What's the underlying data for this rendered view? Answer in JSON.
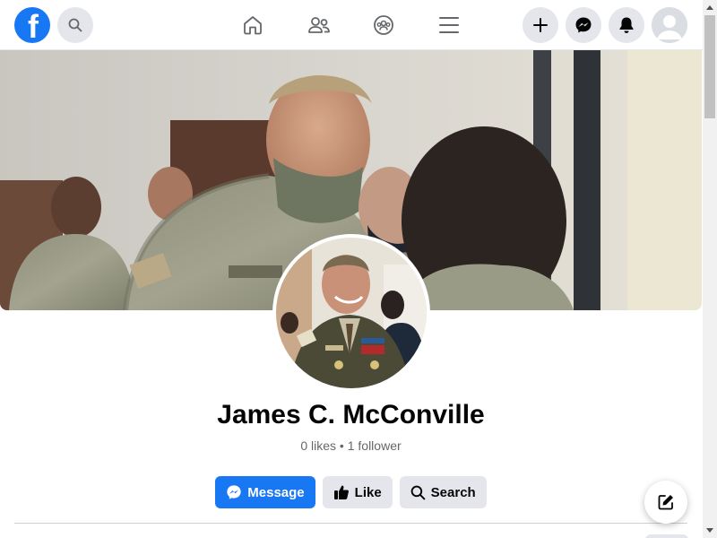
{
  "topbar": {
    "logo_letter": "f",
    "icons": {
      "search": "search-icon",
      "home": "home-icon",
      "friends": "friends-icon",
      "groups": "groups-icon",
      "menu": "menu-icon",
      "create": "plus-icon",
      "messenger": "messenger-icon",
      "notifications": "bell-icon",
      "account": "avatar-icon"
    }
  },
  "profile": {
    "name": "James C. McConville",
    "stats": "0 likes • 1 follower"
  },
  "actions": {
    "message_label": "Message",
    "like_label": "Like",
    "search_label": "Search"
  },
  "colors": {
    "brand": "#1877f2",
    "secondary_button": "#e4e6eb",
    "muted_text": "#65676b"
  }
}
